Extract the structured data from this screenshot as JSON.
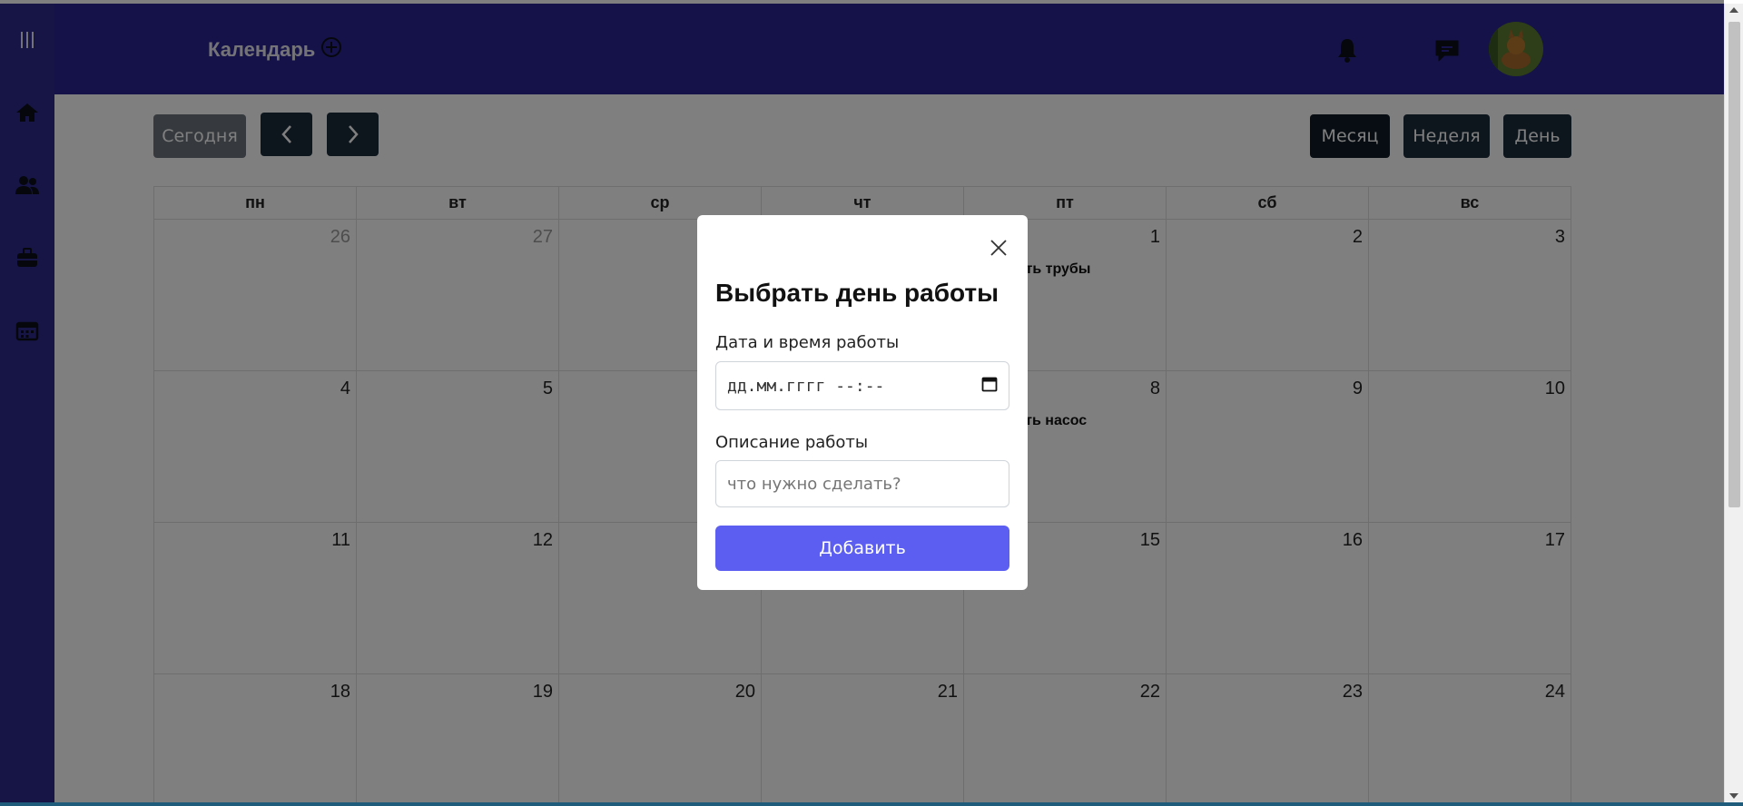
{
  "header": {
    "title": "Календарь"
  },
  "toolbar": {
    "today": "Сегодня",
    "month": "Месяц",
    "week": "Неделя",
    "day": "День"
  },
  "calendar": {
    "weekdays": [
      "пн",
      "вт",
      "ср",
      "чт",
      "пт",
      "сб",
      "вс"
    ],
    "weeks": [
      [
        {
          "d": "26",
          "out": true
        },
        {
          "d": "27",
          "out": true
        },
        {
          "d": "",
          "out": false
        },
        {
          "d": "",
          "out": false
        },
        {
          "d": "1",
          "out": false,
          "event": "Починить трубы"
        },
        {
          "d": "2",
          "out": false
        },
        {
          "d": "3",
          "out": false
        }
      ],
      [
        {
          "d": "4"
        },
        {
          "d": "5"
        },
        {
          "d": ""
        },
        {
          "d": ""
        },
        {
          "d": "8",
          "event": "Заменить насос"
        },
        {
          "d": "9"
        },
        {
          "d": "10"
        }
      ],
      [
        {
          "d": "11"
        },
        {
          "d": "12"
        },
        {
          "d": ""
        },
        {
          "d": ""
        },
        {
          "d": "15"
        },
        {
          "d": "16"
        },
        {
          "d": "17"
        }
      ],
      [
        {
          "d": "18"
        },
        {
          "d": "19"
        },
        {
          "d": "20"
        },
        {
          "d": "21"
        },
        {
          "d": "22"
        },
        {
          "d": "23"
        },
        {
          "d": "24"
        }
      ]
    ]
  },
  "modal": {
    "title": "Выбрать день работы",
    "date_label": "Дата и время работы",
    "date_placeholder": "дд.мм.гггг --:--",
    "desc_label": "Описание работы",
    "desc_placeholder": "что нужно сделать?",
    "submit": "Добавить"
  },
  "colors": {
    "sidebar": "#2d2a8c",
    "header": "#2b2593",
    "primary": "#5b5ef0",
    "dark_button": "#1b2a3a"
  }
}
